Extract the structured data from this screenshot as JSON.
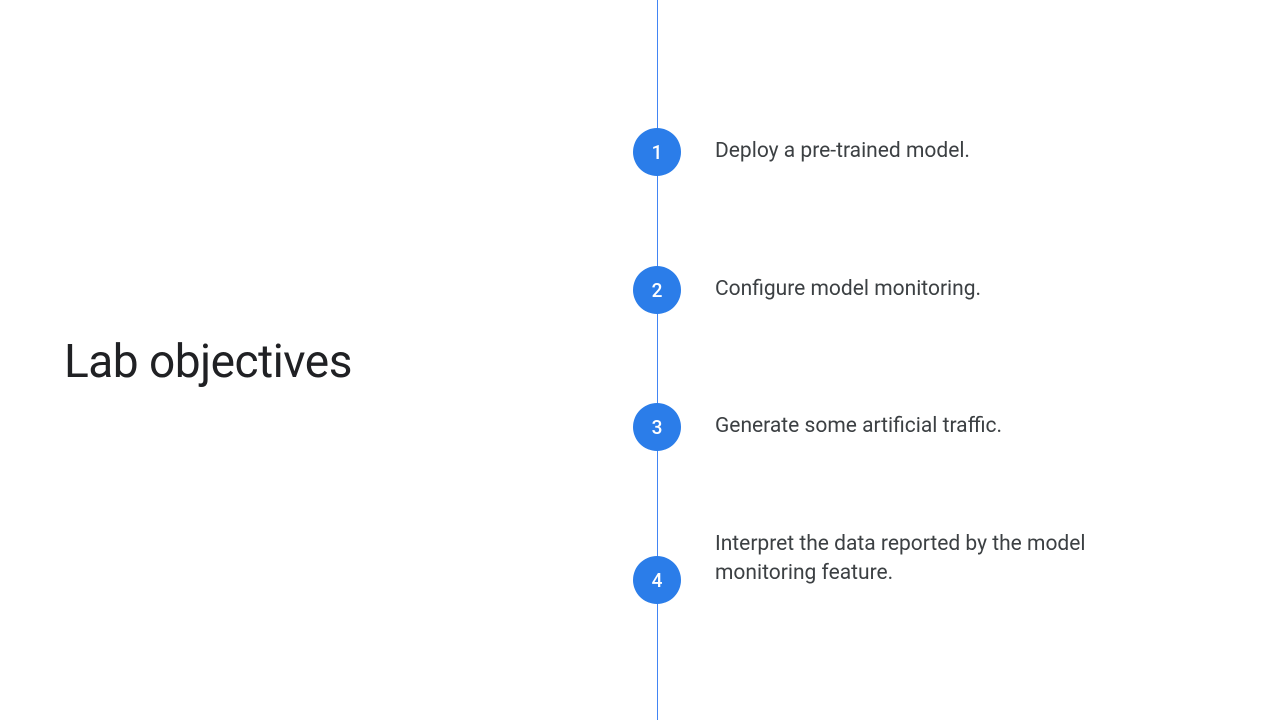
{
  "title": "Lab objectives",
  "items": [
    {
      "num": "1",
      "text": "Deploy a pre-trained model."
    },
    {
      "num": "2",
      "text": "Configure model monitoring."
    },
    {
      "num": "3",
      "text": "Generate some artificial traffic."
    },
    {
      "num": "4",
      "text": "Interpret the data reported by the model monitoring feature."
    }
  ]
}
